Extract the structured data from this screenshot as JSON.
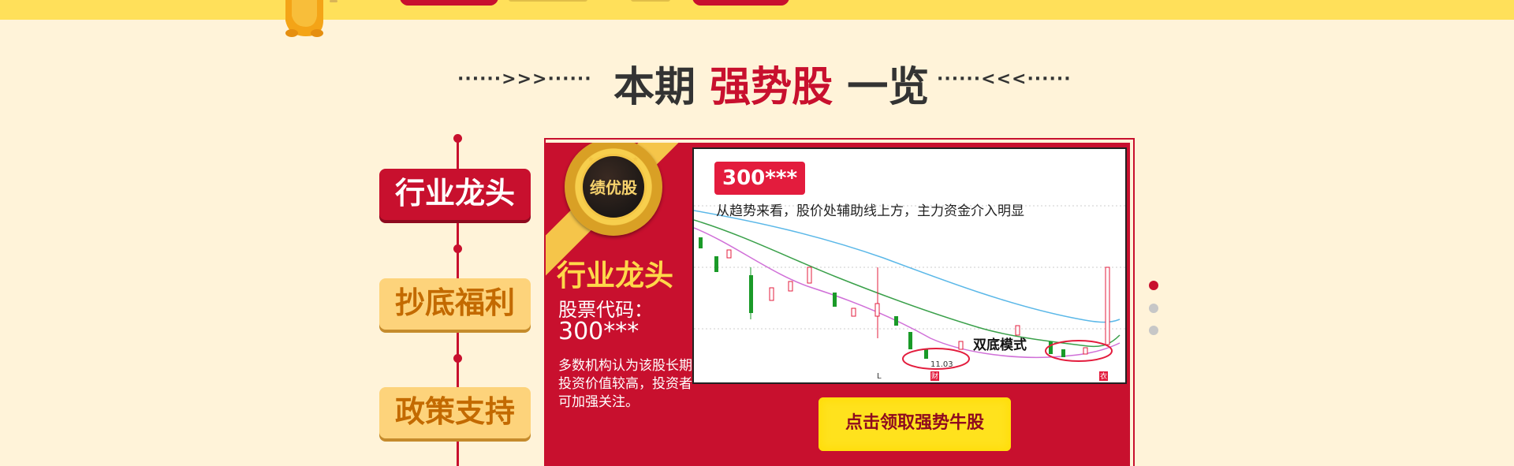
{
  "heading": {
    "left_deco": "······>>>······",
    "title_part1": "本期",
    "title_highlight": "强势股",
    "title_part2": "一览",
    "right_deco": "······<<<······"
  },
  "tabs": [
    {
      "label": "行业龙头",
      "active": true
    },
    {
      "label": "抄底福利",
      "active": false
    },
    {
      "label": "政策支持",
      "active": false
    }
  ],
  "panel": {
    "badge": "绩优股",
    "badge_stars": "★ ★ ★ ★ ★",
    "title": "行业龙头",
    "code_label": "股票代码：",
    "code_value": "300***",
    "description": "多数机构认为该股长期投资价值较高，投资者可加强关注。",
    "cta": "点击领取强势牛股"
  },
  "chart_data": {
    "type": "candlestick",
    "badge": "300***",
    "caption": "从趋势来看，股价处辅助线上方，主力资金介入明显",
    "annotation": "双底模式",
    "date_label": "11.03",
    "markers": [
      "L",
      "财",
      "衣"
    ]
  },
  "carousel": {
    "count": 3,
    "active_index": 0
  },
  "colors": {
    "accent": "#c8102e",
    "gold": "#ffd84a",
    "background": "#fff3d9",
    "topbar": "#ffe05a"
  }
}
